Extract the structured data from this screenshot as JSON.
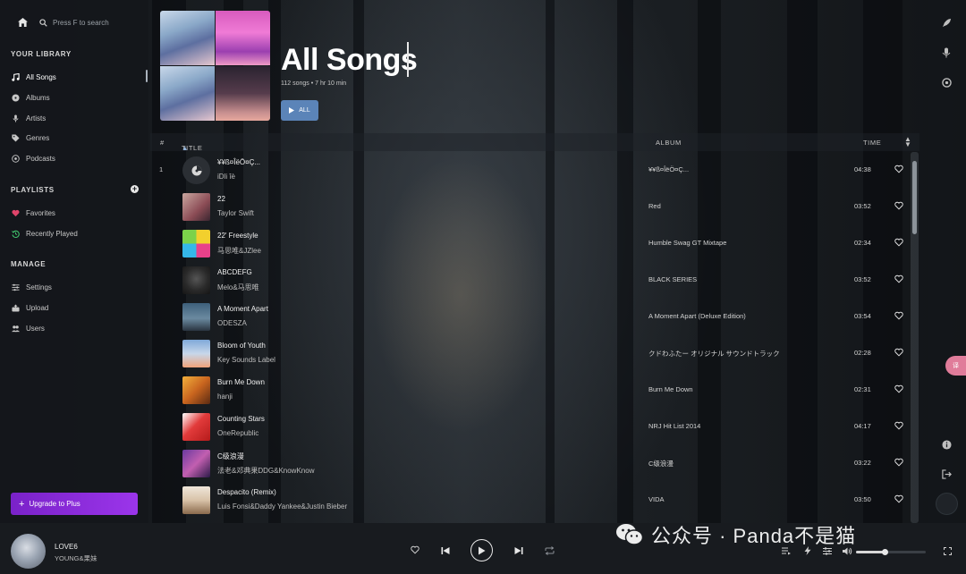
{
  "search": {
    "placeholder": "Press F to search"
  },
  "sidebar": {
    "library_title": "YOUR LIBRARY",
    "library": [
      {
        "label": "All Songs",
        "icon": "music-note-icon",
        "active": true
      },
      {
        "label": "Albums",
        "icon": "disc-icon"
      },
      {
        "label": "Artists",
        "icon": "microphone-icon"
      },
      {
        "label": "Genres",
        "icon": "tag-icon"
      },
      {
        "label": "Podcasts",
        "icon": "podcast-icon"
      }
    ],
    "playlists_title": "PLAYLISTS",
    "playlists": [
      {
        "label": "Favorites",
        "icon": "heart-icon",
        "color": "#e0446a"
      },
      {
        "label": "Recently Played",
        "icon": "history-icon",
        "color": "#3fbf6b"
      }
    ],
    "manage_title": "MANAGE",
    "manage": [
      {
        "label": "Settings",
        "icon": "sliders-icon"
      },
      {
        "label": "Upload",
        "icon": "upload-icon"
      },
      {
        "label": "Users",
        "icon": "users-icon"
      }
    ],
    "upgrade_label": "Upgrade to Plus",
    "upgrade_color": "#8a2be2"
  },
  "header": {
    "title": "All Songs",
    "meta": "112 songs • 7 hr 10 min",
    "play_all_label": "ALL",
    "accent": "#5b84b8"
  },
  "table": {
    "columns": {
      "num": "#",
      "title": "TITLE",
      "album": "ALBUM",
      "time": "TIME"
    },
    "rows": [
      {
        "num": "1",
        "title": "¥¥ß¤ÎëÖ¤Ç...",
        "artist": "iDli îè",
        "album": "¥¥ß¤ÎëÖ¤Ç...",
        "time": "04:38"
      },
      {
        "num": "",
        "title": "22",
        "artist": "Taylor Swift",
        "album": "Red",
        "time": "03:52"
      },
      {
        "num": "",
        "title": "22' Freestyle",
        "artist": "马思唯&JZlee",
        "album": "Humble Swag GT Mixtape",
        "time": "02:34"
      },
      {
        "num": "",
        "title": "ABCDEFG",
        "artist": "Melo&马思唯",
        "album": "BLACK SERIES",
        "time": "03:52"
      },
      {
        "num": "",
        "title": "A Moment Apart",
        "artist": "ODESZA",
        "album": "A Moment Apart (Deluxe Edition)",
        "time": "03:54"
      },
      {
        "num": "",
        "title": "Bloom of Youth",
        "artist": "Key Sounds Label",
        "album": "クドわふたー オリジナル サウンドトラック",
        "time": "02:28"
      },
      {
        "num": "",
        "title": "Burn Me Down",
        "artist": "hanji",
        "album": "Burn Me Down",
        "time": "02:31"
      },
      {
        "num": "",
        "title": "Counting Stars",
        "artist": "OneRepublic",
        "album": "NRJ Hit List 2014",
        "time": "04:17"
      },
      {
        "num": "",
        "title": "C级浪漫",
        "artist": "法老&邓典果DDG&KnowKnow",
        "album": "C级浪漫",
        "time": "03:22"
      },
      {
        "num": "",
        "title": "Despacito (Remix)",
        "artist": "Luis Fonsi&Daddy Yankee&Justin Bieber",
        "album": "VIDA",
        "time": "03:50"
      }
    ]
  },
  "now_playing": {
    "title": "LOVE6",
    "artist": "YOUNG&果妹",
    "volume": 0.42
  },
  "watermark": {
    "text": "公众号 · Panda不是猫"
  },
  "translate_badge": "译"
}
